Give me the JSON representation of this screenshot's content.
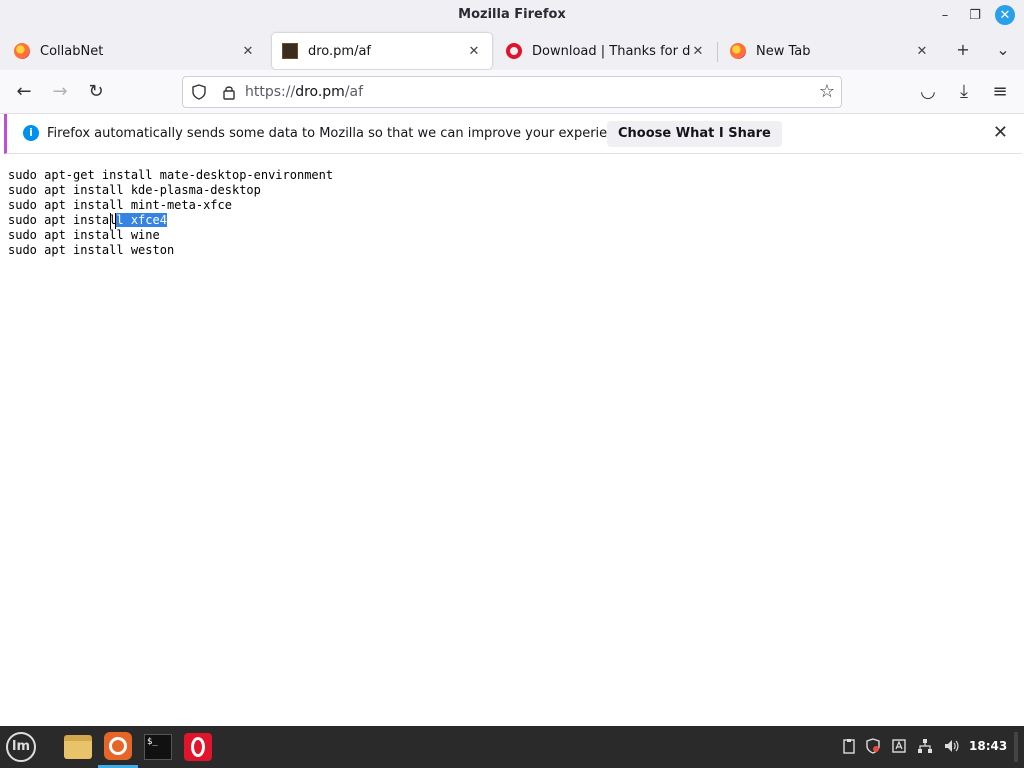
{
  "window": {
    "title": "Mozilla Firefox",
    "minimize_glyph": "–",
    "maximize_glyph": "❐",
    "close_glyph": "✕"
  },
  "tabs": [
    {
      "title": "CollabNet",
      "icon": "firefox-icon",
      "active": false
    },
    {
      "title": "dro.pm/af",
      "icon": "dropm-icon",
      "active": true
    },
    {
      "title": "Download | Thanks for downloading",
      "icon": "opera-icon",
      "active": false
    },
    {
      "title": "New Tab",
      "icon": "firefox-icon",
      "active": false
    }
  ],
  "tab_close_glyph": "✕",
  "new_tab_glyph": "+",
  "list_tabs_glyph": "⌄",
  "nav": {
    "back_glyph": "←",
    "forward_glyph": "→",
    "reload_glyph": "↻",
    "url_scheme": "https://",
    "url_host": "dro.pm",
    "url_path": "/af",
    "bookmark_glyph": "☆",
    "pocket_glyph": "◡",
    "downloads_glyph": "⤓",
    "menu_glyph": "≡"
  },
  "notification": {
    "message": "Firefox automatically sends some data to Mozilla so that we can improve your experience.",
    "button_label": "Choose What I Share",
    "info_glyph": "i",
    "close_glyph": "✕"
  },
  "content": {
    "lines": [
      "sudo apt-get install mate-desktop-environment",
      "sudo apt install kde-plasma-desktop",
      "sudo apt install mint-meta-xfce",
      "sudo apt install xfce4",
      "sudo apt install wine",
      "sudo apt install weston"
    ],
    "selected_line_index": 3,
    "selection_prefix": "sudo apt instal",
    "selection_text": "l xfce4"
  },
  "taskbar": {
    "menu_label": "lm",
    "apps": [
      {
        "name": "files",
        "active": false
      },
      {
        "name": "firefox",
        "active": true
      },
      {
        "name": "terminal",
        "active": false
      },
      {
        "name": "opera",
        "active": false
      }
    ],
    "terminal_prompt": "$_",
    "clock": "18:43"
  },
  "colors": {
    "selection": "#3584e4",
    "accent": "#3daee9",
    "notification_stripe": "#c04ddb",
    "info_blue": "#0090ed"
  }
}
